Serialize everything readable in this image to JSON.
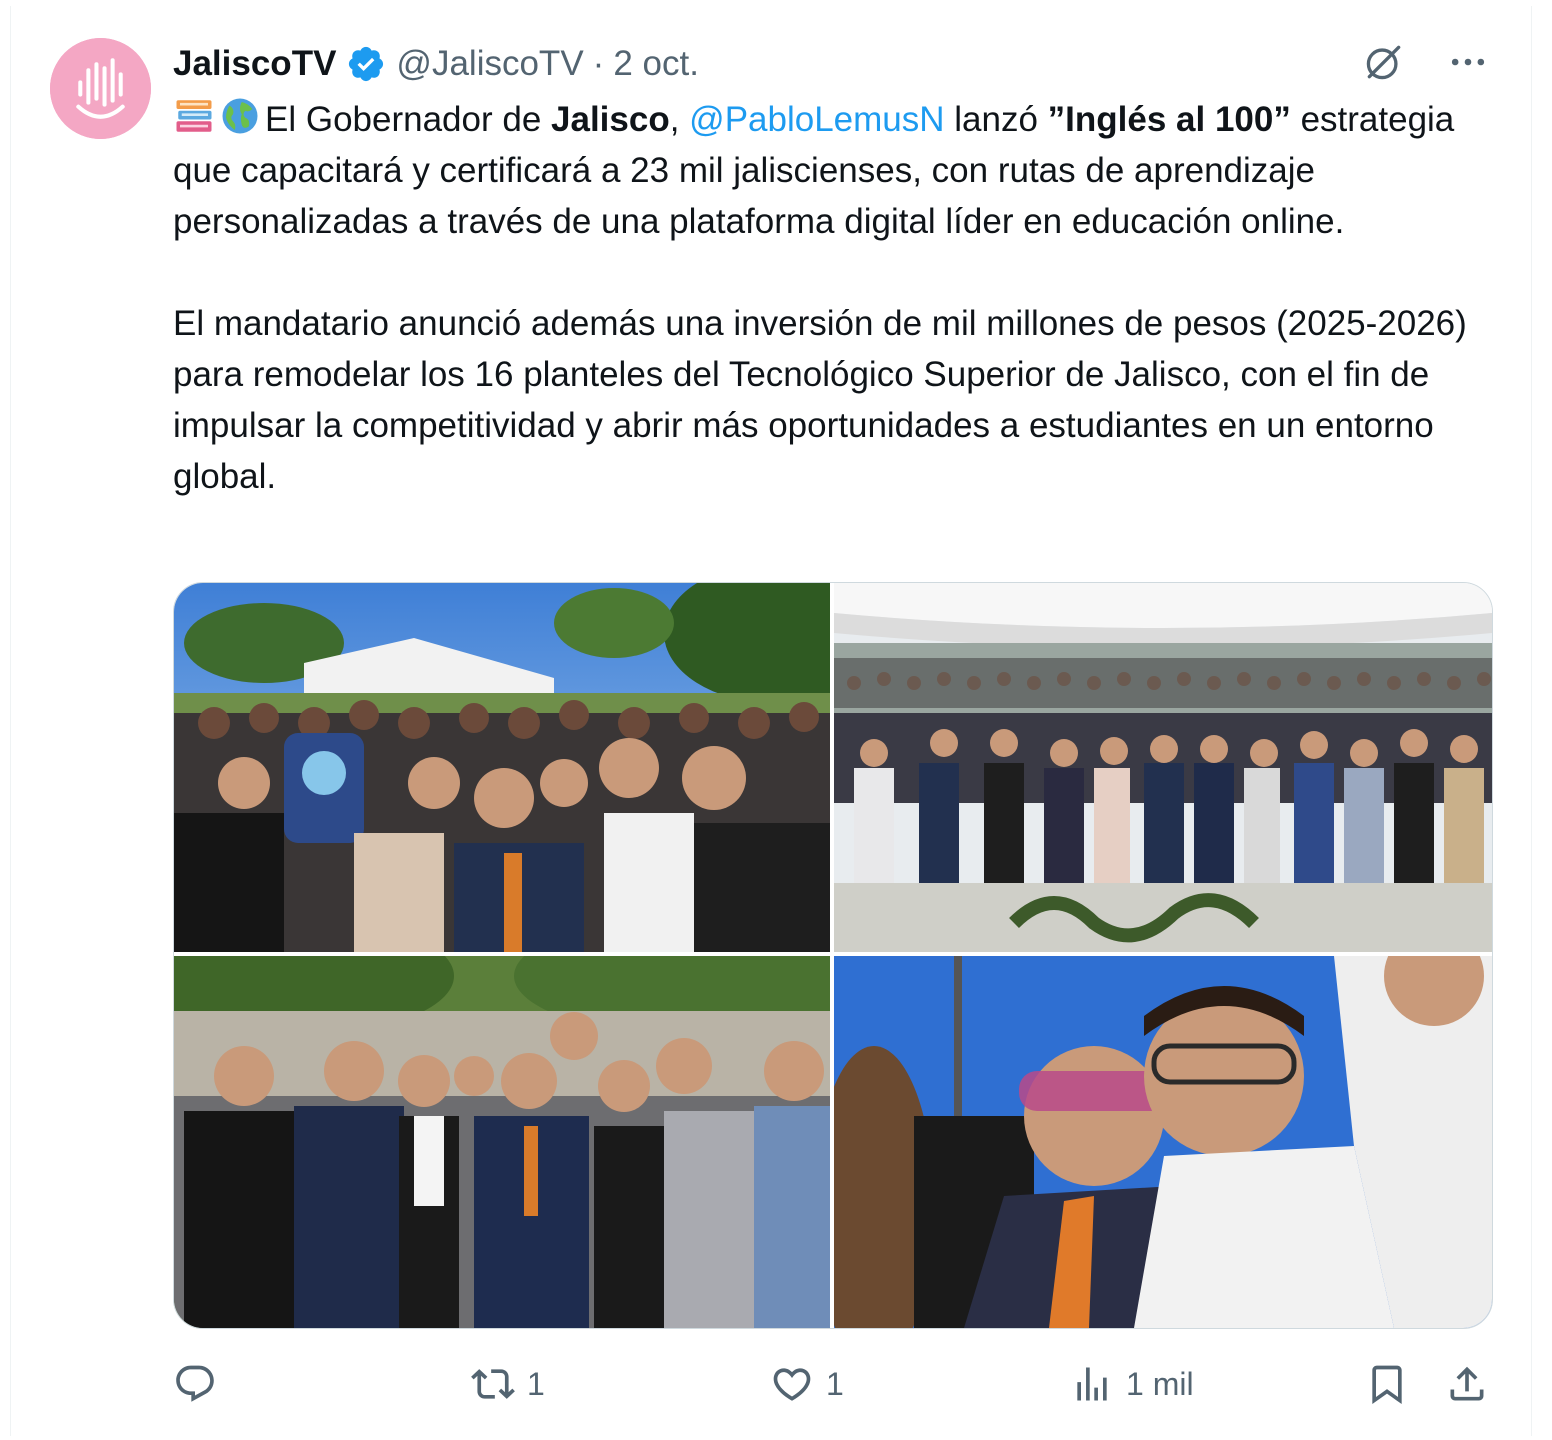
{
  "author": {
    "display_name": "JaliscoTV",
    "handle": "@JaliscoTV",
    "separator": "·",
    "date": "2 oct."
  },
  "tweet": {
    "p1_part1": "El Gobernador de ",
    "p1_bold1": "Jalisco",
    "p1_part2": ", ",
    "p1_mention": "@PabloLemusN",
    "p1_part3": " lanzó ",
    "p1_bold2": "”Inglés al 100”",
    "p1_part4": " estrategia que capacitará y certificará a 23 mil jaliscienses, con rutas de aprendizaje personalizadas a través de una plataforma digital líder en educación online.",
    "p2": "El mandatario anunció además una inversión de mil millones de pesos (2025-2026) para remodelar los 16 planteles del Tecnológico Superior de Jalisco, con el fin de impulsar la competitividad y abrir más oportunidades a estudiantes en un entorno global."
  },
  "icons": {
    "verified": "verified-badge-icon",
    "grok": "grok-icon",
    "more": "more-icon",
    "reply": "reply-icon",
    "retweet": "retweet-icon",
    "like": "like-icon",
    "views": "views-icon",
    "bookmark": "bookmark-icon",
    "share": "share-icon"
  },
  "colors": {
    "link": "#1d9bf0",
    "secondary": "#536471",
    "verified": "#1d9bf0",
    "avatar": "#f4a7c4"
  },
  "actions": {
    "reply_count": "",
    "retweet_count": "1",
    "like_count": "1",
    "views_count": "1 mil"
  }
}
